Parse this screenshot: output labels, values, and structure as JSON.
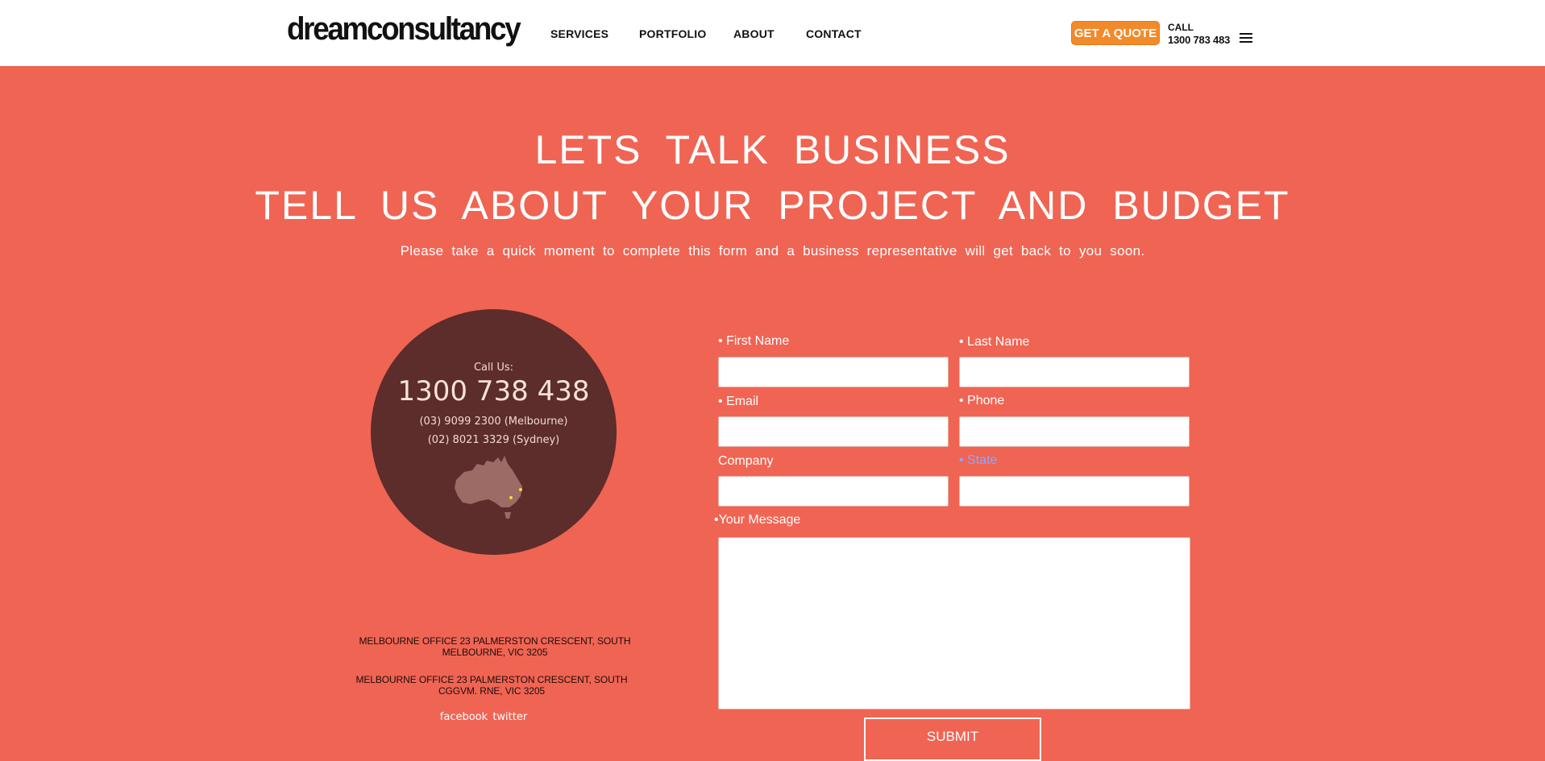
{
  "header": {
    "logo": "dreamconsultancy",
    "nav": [
      "SERVICES",
      "PORTFOLIO",
      "ABOUT",
      "CONTACT"
    ],
    "quote_button": "GET A QUOTE",
    "call_label": "CALL",
    "call_number": "1300 783 483"
  },
  "hero": {
    "title": "LETS TALK BUSINESS",
    "subtitle": "TELL US ABOUT YOUR PROJECT AND BUDGET",
    "intro": "Please take a quick moment to complete this form and a business representative will get back to you soon."
  },
  "contact_card": {
    "call_us": "Call Us:",
    "phone": "1300 738 438",
    "melbourne": "(03) 9099 2300 (Melbourne)",
    "sydney": "(02) 8021 3329 (Sydney)"
  },
  "addresses": [
    "MELBOURNE OFFICE 23 PALMERSTON CRESCENT, SOUTH MELBOURNE, VIC 3205",
    "MELBOURNE OFFICE 23 PALMERSTON CRESCENT, SOUTH CGGVM. RNE, VIC 3205"
  ],
  "social": {
    "facebook": "facebook",
    "twitter": "twitter"
  },
  "form": {
    "first_name": "• First Name",
    "last_name": "• Last Name",
    "email": "• Email",
    "phone": "• Phone",
    "company": "Company",
    "state": "• State",
    "message": "•Your Message",
    "submit": "SUBMIT"
  },
  "colors": {
    "hero_bg": "#f06453",
    "circle_bg": "#5c2d2a",
    "quote_button": "#f28a2a",
    "state_label": "#8fa7ff"
  }
}
